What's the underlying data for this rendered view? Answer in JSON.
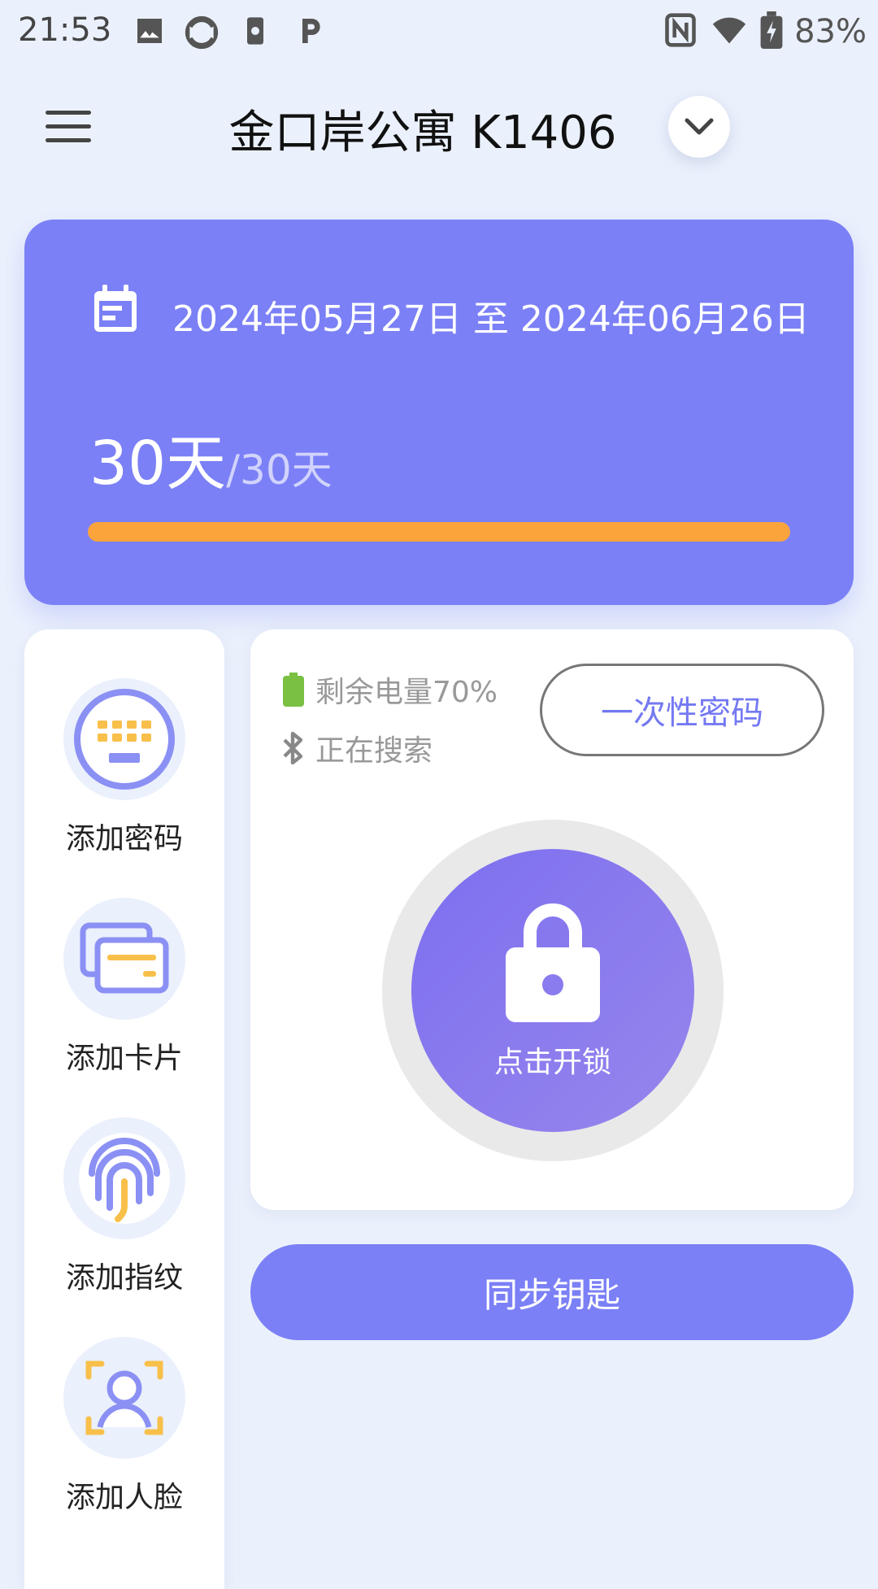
{
  "status_bar": {
    "time": "21:53",
    "battery": "83%",
    "icons": [
      "image-icon",
      "sync-icon",
      "settings-phone-icon",
      "p-icon",
      "nfc-icon",
      "wifi-icon",
      "battery-charging-icon"
    ]
  },
  "header": {
    "title": "金口岸公寓 K1406",
    "menu_icon": "menu-icon",
    "dropdown_icon": "chevron-down-icon"
  },
  "period": {
    "date_range": "2024年05月27日 至 2024年06月26日",
    "days_left": "30天",
    "separator": "/",
    "days_total": "30天",
    "progress_fraction": 1.0,
    "progress_color": "#fba43b"
  },
  "actions": [
    {
      "label": "添加密码",
      "icon": "keypad-icon"
    },
    {
      "label": "添加卡片",
      "icon": "card-icon"
    },
    {
      "label": "添加指纹",
      "icon": "fingerprint-icon"
    },
    {
      "label": "添加人脸",
      "icon": "face-icon"
    }
  ],
  "lock": {
    "battery_text": "剩余电量70%",
    "bluetooth_text": "正在搜索",
    "otp_label": "一次性密码",
    "unlock_label": "点击开锁"
  },
  "sync": {
    "label": "同步钥匙"
  },
  "colors": {
    "accent": "#7b80f6",
    "progress": "#fba43b",
    "background": "#ebf1fc",
    "battery_green": "#7ac143"
  }
}
